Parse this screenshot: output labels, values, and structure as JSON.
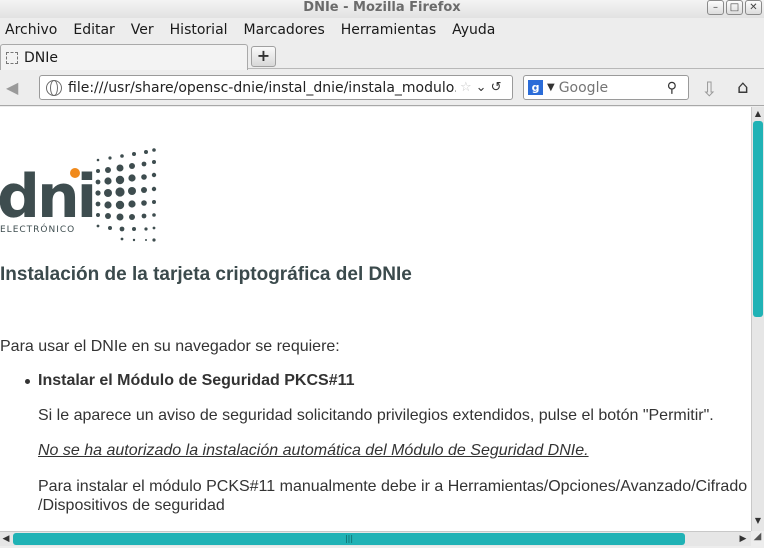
{
  "window": {
    "title": "DNIe - Mozilla Firefox"
  },
  "menu": [
    "Archivo",
    "Editar",
    "Ver",
    "Historial",
    "Marcadores",
    "Herramientas",
    "Ayuda"
  ],
  "tab": {
    "label": "DNIe",
    "new_tab": "+"
  },
  "nav": {
    "url": "file:///usr/share/opensc-dnie/instal_dnie/instala_modulo.htm",
    "search_placeholder": "Google",
    "search_engine_letter": "g"
  },
  "logo": {
    "wordmark": "dni",
    "subtitle": "ELECTRÓNICO"
  },
  "page": {
    "heading": "Instalación de la tarjeta criptográfica del DNIe",
    "intro": "Para usar el DNIe en su navegador se requiere:",
    "bullet_title": "Instalar el Módulo de Seguridad PKCS#11",
    "p1": "Si le aparece un aviso de seguridad solicitando privilegios extendidos, pulse el botón \"Permitir\".",
    "p2": "No se ha autorizado la instalación automática del Módulo de Seguridad DNIe.",
    "p3_line1": "Para instalar el módulo PCKS#11 manualmente debe ir a Herramientas/Opciones/Avanzado/Cifrado",
    "p3_line2": "/Dispositivos de seguridad"
  },
  "colors": {
    "scroll_thumb": "#20b2b5",
    "logo_orange": "#f08a1c",
    "logo_dark": "#3e4d4f"
  }
}
